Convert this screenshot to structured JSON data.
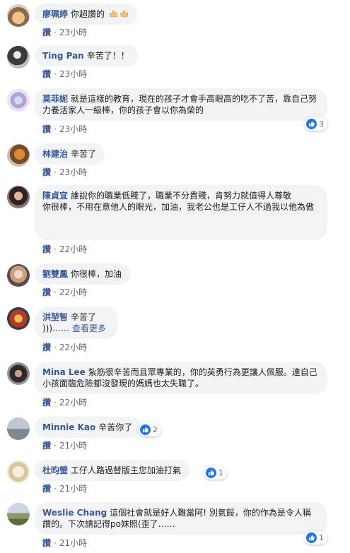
{
  "actions": {
    "like_label": "讚",
    "separator": "·"
  },
  "comments": [
    {
      "name": "廖珮婷",
      "text": "你超讚的",
      "emoji": true,
      "time": "23小時",
      "reactions": null
    },
    {
      "name": "Ting Pan",
      "text": "辛苦了！！",
      "time": "23小時",
      "reactions": null
    },
    {
      "name": "莫菲妮",
      "text": "就是這樣的教育，現在的孩子才會手高眼高的吃不了苦，靠自己努力養活家人一級棒，你的孩子會以你為榮的",
      "time": "23小時",
      "reactions": "3"
    },
    {
      "name": "林建治",
      "text": "辛苦了",
      "time": "23小時",
      "reactions": null
    },
    {
      "name": "陳貞宜",
      "text": "誰說你的職業低賤了，職業不分貴賤，肯努力就值得人尊敬\n你很棒，不用在意他人的眼光，加油，我老公也是工仔人不過我以他為傲",
      "time": "22小時",
      "reactions": null
    },
    {
      "name": "劉雙鳳",
      "text": "你很棒，加油",
      "time": "22小時",
      "reactions": null
    },
    {
      "name": "洪堃智",
      "text": "辛苦了\n)))……",
      "see_more": "查看更多",
      "time": "22小時",
      "reactions": null
    },
    {
      "name": "Mina Lee",
      "text": "紮筋很辛苦而且眾專業的，你的英勇行為更讓人佩服。連自己小孩面臨危險都沒發現的媽媽也太失職了。",
      "time": "22小時",
      "reactions": null
    },
    {
      "name": "Minnie Kao",
      "text": "辛苦你了",
      "time": "21小時",
      "reactions": "2"
    },
    {
      "name": "杜昀螢",
      "text": "工仔人路過替版主您加油打氣",
      "time": "21小時",
      "reactions": "1"
    },
    {
      "name": "Weslie Chang",
      "text": "這個社會就是好人難當阿! 別氣餒，你的作為是令人稱讚的。下次請記得po妹照(歪了……",
      "time": "21小時",
      "reactions": "1"
    }
  ],
  "colors": {
    "name": "#385898",
    "bubble": "#f2f3f5",
    "like_blue": "#1877f2",
    "meta": "#616770"
  }
}
